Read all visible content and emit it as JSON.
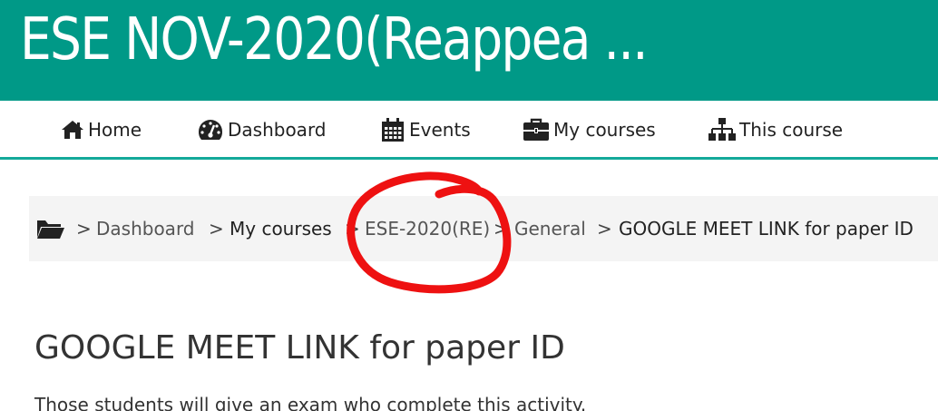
{
  "header": {
    "title": "ESE NOV-2020(Reappea ...",
    "background_color": "#009987"
  },
  "nav": {
    "items": [
      {
        "label": "Home",
        "icon": "home-icon"
      },
      {
        "label": "Dashboard",
        "icon": "dashboard-icon"
      },
      {
        "label": "Events",
        "icon": "calendar-icon"
      },
      {
        "label": "My courses",
        "icon": "briefcase-icon"
      },
      {
        "label": "This course",
        "icon": "sitemap-icon"
      }
    ]
  },
  "breadcrumb": {
    "home_icon": "folder-open-icon",
    "separator": ">",
    "items": [
      {
        "label": "Dashboard"
      },
      {
        "label": "My courses"
      },
      {
        "label": "ESE-2020(RE)"
      },
      {
        "label": "General"
      },
      {
        "label": "GOOGLE MEET LINK for paper ID"
      }
    ]
  },
  "annotation": {
    "type": "red-circle",
    "color": "#ee1111",
    "target": "ESE-2020(RE)"
  },
  "main": {
    "heading": "GOOGLE MEET LINK for paper ID",
    "intro": "Those students will give an exam who complete this activity."
  }
}
